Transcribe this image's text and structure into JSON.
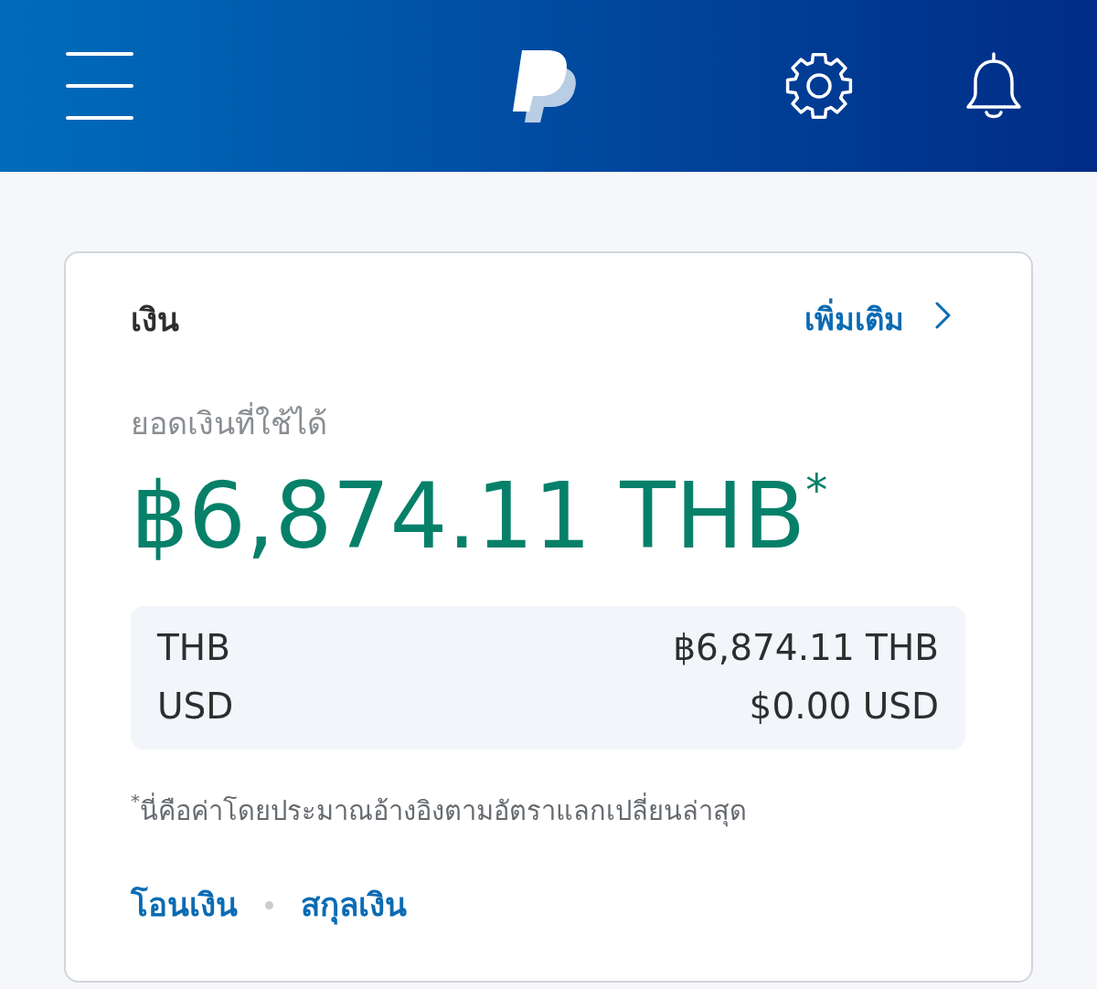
{
  "card": {
    "title": "เงิน",
    "more_link": "เพิ่มเติม",
    "balance_label": "ยอดเงินที่ใช้ได้",
    "balance": "฿6,874.11 THB$^{*}$",
    "currencies": [
      {
        "code": "THB",
        "amount": "฿6,874.11 THB"
      },
      {
        "code": "USD",
        "amount": "$0.00 USD"
      }
    ],
    "footnote": "$^{*}$นี่คือค่าโดยประมาณอ้างอิงตามอัตราแลกเปลี่ยนล่าสุด",
    "actions": [
      "โอนเงิน",
      "สกุลเงิน"
    ]
  }
}
